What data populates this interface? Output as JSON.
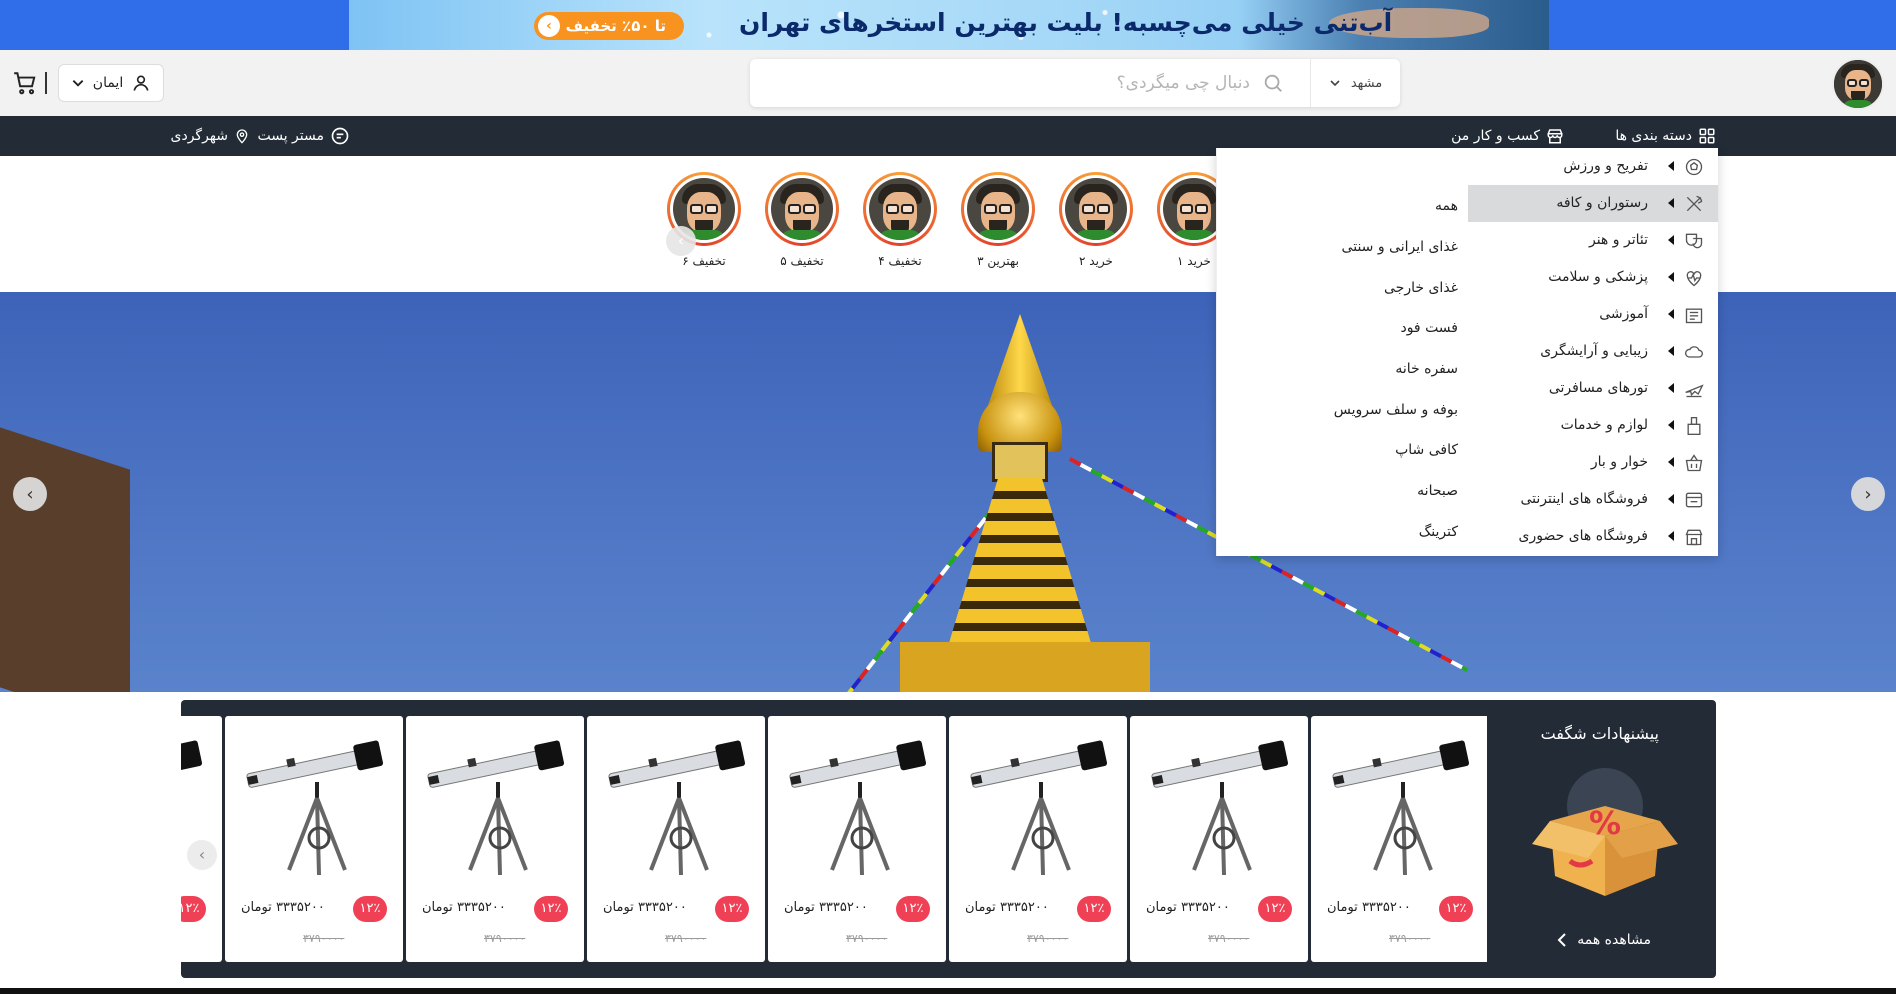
{
  "promo": {
    "headline": "آب‌تنی خیلی می‌چسبه! بلیت بهترین استخرهای تهران",
    "cta": "تا ۵۰٪ تخفیف"
  },
  "header": {
    "search_placeholder": "دنبال چی میگردی؟",
    "city": "مشهد",
    "user_name": "ایمان"
  },
  "navbar": {
    "categories": "دسته بندی ها",
    "business": "کسب و کار من",
    "mister_post": "مستر پست",
    "city_tour": "شهرگردی"
  },
  "stories": [
    {
      "label": "خرید ۱"
    },
    {
      "label": "خرید ۲"
    },
    {
      "label": "بهترین ۳"
    },
    {
      "label": "تخفیف ۴"
    },
    {
      "label": "تخفیف ۵"
    },
    {
      "label": "تخفیف ۶"
    }
  ],
  "categories": [
    {
      "label": "تفریح و ورزش",
      "icon": "sports-icon"
    },
    {
      "label": "رستوران و کافه",
      "icon": "restaurant-icon",
      "active": true
    },
    {
      "label": "تئاتر و هنر",
      "icon": "theater-icon"
    },
    {
      "label": "پزشکی و سلامت",
      "icon": "health-icon"
    },
    {
      "label": "آموزشی",
      "icon": "education-icon"
    },
    {
      "label": "زیبایی و آرایشگری",
      "icon": "beauty-icon"
    },
    {
      "label": "تورهای مسافرتی",
      "icon": "travel-icon"
    },
    {
      "label": "لوازم و خدمات",
      "icon": "services-icon"
    },
    {
      "label": "خوار و بار",
      "icon": "grocery-icon"
    },
    {
      "label": "فروشگاه های اینترنتی",
      "icon": "online-store-icon"
    },
    {
      "label": "فروشگاه های حضوری",
      "icon": "store-icon"
    }
  ],
  "subcategories": [
    "همه",
    "غذای ایرانی و سنتی",
    "غذای خارجی",
    "فست فود",
    "سفره خانه",
    "بوفه و سلف سرویس",
    "کافی شاپ",
    "صبحانه",
    "کترینگ"
  ],
  "offers": {
    "title": "پیشنهادات شگفت",
    "see_all": "مشاهده همه",
    "products": [
      {
        "price": "۳۳۳۵۲۰۰ تومان",
        "old_price": "۳۷۹۰۰۰۰",
        "discount": "۱۲٪"
      },
      {
        "price": "۳۳۳۵۲۰۰ تومان",
        "old_price": "۳۷۹۰۰۰۰",
        "discount": "۱۲٪"
      },
      {
        "price": "۳۳۳۵۲۰۰ تومان",
        "old_price": "۳۷۹۰۰۰۰",
        "discount": "۱۲٪"
      },
      {
        "price": "۳۳۳۵۲۰۰ تومان",
        "old_price": "۳۷۹۰۰۰۰",
        "discount": "۱۲٪"
      },
      {
        "price": "۳۳۳۵۲۰۰ تومان",
        "old_price": "۳۷۹۰۰۰۰",
        "discount": "۱۲٪"
      },
      {
        "price": "۳۳۳۵۲۰۰ تومان",
        "old_price": "۳۷۹۰۰۰۰",
        "discount": "۱۲٪"
      },
      {
        "price": "۳۳۳۵۲۰۰ تومان",
        "old_price": "۳۷۹۰۰۰۰",
        "discount": "۱۲٪"
      },
      {
        "price": "",
        "old_price": "",
        "discount": "۱۲٪"
      }
    ]
  },
  "colors": {
    "navbar": "#222b36",
    "promo_cta": "#f7931e",
    "discount_badge": "#ef4056",
    "active_category": "#d9dadc"
  }
}
